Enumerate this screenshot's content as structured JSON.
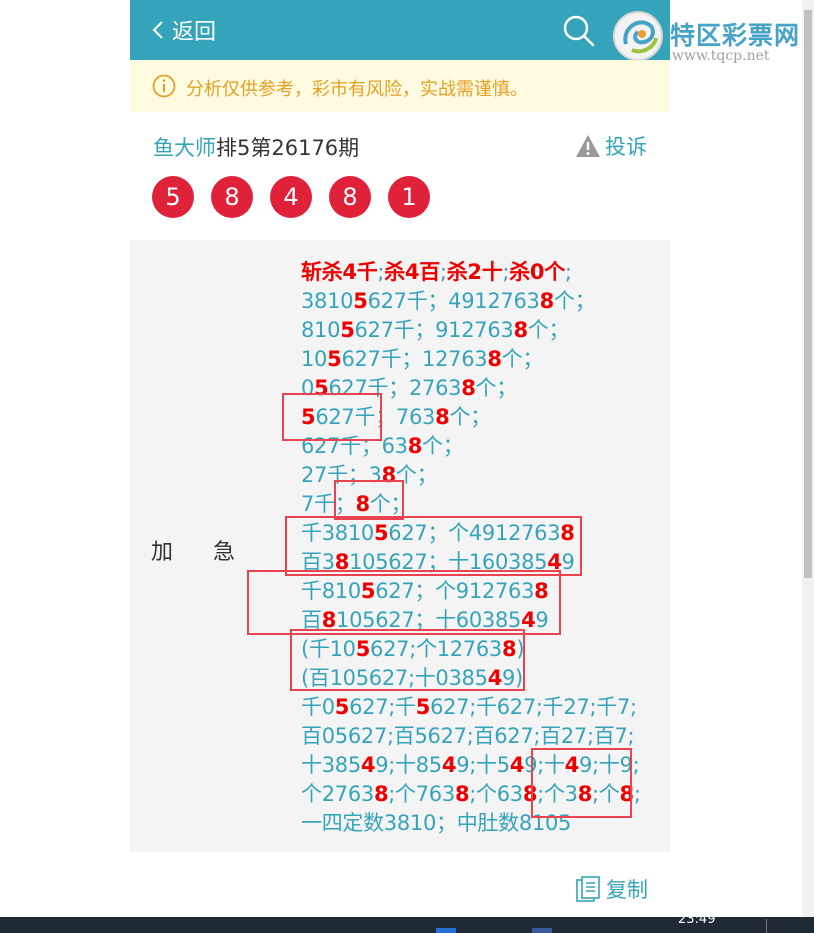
{
  "header": {
    "back_label": "返回"
  },
  "logo": {
    "name": "特区彩票网",
    "url": "www.tqcp.net"
  },
  "notice": {
    "text": "分析仅供参考，彩市有风险，实战需谨慎。"
  },
  "post": {
    "author": "鱼大师",
    "title": "排5第26176期",
    "complaint_label": "投诉",
    "balls": [
      "5",
      "8",
      "4",
      "8",
      "1"
    ]
  },
  "content": {
    "urgent_label_1": "加",
    "urgent_label_2": "急",
    "lines": [
      [
        {
          "t": "斩杀4千",
          "h": true
        },
        {
          "t": ";"
        },
        {
          "t": "杀4百",
          "h": true
        },
        {
          "t": ";"
        },
        {
          "t": "杀2十",
          "h": true
        },
        {
          "t": ";"
        },
        {
          "t": "杀0个",
          "h": true
        },
        {
          "t": ";"
        }
      ],
      [
        {
          "t": "3810"
        },
        {
          "t": "5",
          "h": true
        },
        {
          "t": "627千；4912763"
        },
        {
          "t": "8",
          "h": true
        },
        {
          "t": "个；"
        }
      ],
      [
        {
          "t": "810"
        },
        {
          "t": "5",
          "h": true
        },
        {
          "t": "627千；912763"
        },
        {
          "t": "8",
          "h": true
        },
        {
          "t": "个；"
        }
      ],
      [
        {
          "t": "10"
        },
        {
          "t": "5",
          "h": true
        },
        {
          "t": "627千；12763"
        },
        {
          "t": "8",
          "h": true
        },
        {
          "t": "个；"
        }
      ],
      [
        {
          "t": "0"
        },
        {
          "t": "5",
          "h": true
        },
        {
          "t": "627千；2763"
        },
        {
          "t": "8",
          "h": true
        },
        {
          "t": "个；"
        }
      ],
      [
        {
          "t": "5",
          "h": true
        },
        {
          "t": "627千；763"
        },
        {
          "t": "8",
          "h": true
        },
        {
          "t": "个；"
        }
      ],
      [
        {
          "t": "627千；63"
        },
        {
          "t": "8",
          "h": true
        },
        {
          "t": "个；"
        }
      ],
      [
        {
          "t": "27千；3"
        },
        {
          "t": "8",
          "h": true
        },
        {
          "t": "个；"
        }
      ],
      [
        {
          "t": "7千；"
        },
        {
          "t": "8",
          "h": true
        },
        {
          "t": "个；"
        }
      ],
      [
        {
          "t": "千3810"
        },
        {
          "t": "5",
          "h": true
        },
        {
          "t": "627；个4912763"
        },
        {
          "t": "8",
          "h": true
        }
      ],
      [
        {
          "t": "百3"
        },
        {
          "t": "8",
          "h": true
        },
        {
          "t": "105627；十160385"
        },
        {
          "t": "4",
          "h": true
        },
        {
          "t": "9"
        }
      ],
      [
        {
          "t": "千810"
        },
        {
          "t": "5",
          "h": true
        },
        {
          "t": "627；个912763"
        },
        {
          "t": "8",
          "h": true
        }
      ],
      [
        {
          "t": "百"
        },
        {
          "t": "8",
          "h": true
        },
        {
          "t": "105627；十60385"
        },
        {
          "t": "4",
          "h": true
        },
        {
          "t": "9"
        }
      ],
      [
        {
          "t": "(千10"
        },
        {
          "t": "5",
          "h": true
        },
        {
          "t": "627;个12763"
        },
        {
          "t": "8",
          "h": true
        },
        {
          "t": ")"
        }
      ],
      [
        {
          "t": "(百105627;十0385"
        },
        {
          "t": "4",
          "h": true
        },
        {
          "t": "9)"
        }
      ],
      [
        {
          "t": "千0"
        },
        {
          "t": "5",
          "h": true
        },
        {
          "t": "627;千"
        },
        {
          "t": "5",
          "h": true
        },
        {
          "t": "627;千627;千27;千7;"
        }
      ],
      [
        {
          "t": "百05627;百5627;百627;百27;百7;"
        }
      ],
      [
        {
          "t": "十385"
        },
        {
          "t": "4",
          "h": true
        },
        {
          "t": "9;十85"
        },
        {
          "t": "4",
          "h": true
        },
        {
          "t": "9;十5"
        },
        {
          "t": "4",
          "h": true
        },
        {
          "t": "9;十"
        },
        {
          "t": "4",
          "h": true
        },
        {
          "t": "9;十9;"
        }
      ],
      [
        {
          "t": "个2763"
        },
        {
          "t": "8",
          "h": true
        },
        {
          "t": ";个763"
        },
        {
          "t": "8",
          "h": true
        },
        {
          "t": ";个63"
        },
        {
          "t": "8",
          "h": true
        },
        {
          "t": ";个3"
        },
        {
          "t": "8",
          "h": true
        },
        {
          "t": ";个"
        },
        {
          "t": "8",
          "h": true
        },
        {
          "t": ";"
        }
      ],
      [
        {
          "t": "一四定数3810；中肚数8105"
        }
      ]
    ]
  },
  "actions": {
    "copy_label": "复制"
  },
  "taskbar": {
    "clock": "23:49"
  },
  "colors": {
    "header": "#35a4bb",
    "ball": "#e0213a",
    "highlight": "#ee0000",
    "notice_text": "#e3a025",
    "annotation_box": "#e8434e"
  }
}
